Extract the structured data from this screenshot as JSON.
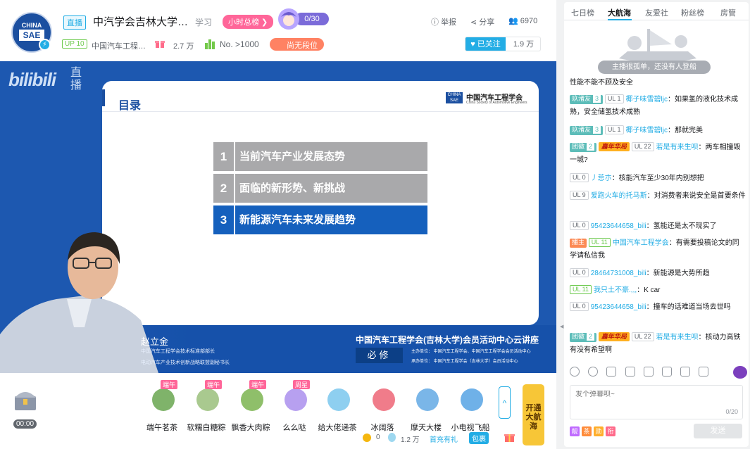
{
  "header": {
    "status": "直播",
    "title": "中汽学会吉林大学…",
    "area": "学习",
    "rank_pill": "小时总榜 ❯",
    "guard_count": "0/30",
    "report": "举报",
    "share": "分享",
    "viewers": "6970",
    "avatar_text_top": "CHINA",
    "avatar_text_main": "SAE",
    "up_level": "UP 10",
    "org_name": "中国汽车工程…",
    "gift_value": "2.7 万",
    "rank": "No. >1000",
    "segment": "尚无段位",
    "follow": "已关注",
    "fans": "1.9 万"
  },
  "player": {
    "logo": "bilibili",
    "logo_live": "直播",
    "slide": {
      "title": "目录",
      "org_logo": "CHINA SAE",
      "org_cn": "中国汽车工程学会",
      "org_en": "China Society of Automotive Engineers",
      "items": [
        {
          "num": "1",
          "text": "当前汽车产业发展态势"
        },
        {
          "num": "2",
          "text": "面临的新形势、新挑战"
        },
        {
          "num": "3",
          "text": "新能源汽车未来发展趋势"
        }
      ]
    },
    "speaker_name": "赵立金",
    "speaker_role1": "中国汽车工程学会技术标准部部长",
    "speaker_role2": "电动汽车产业技术创新战略联盟副秘书长",
    "lecture": "中国汽车工程学会(吉林大学)会员活动中心云讲座",
    "required": "必修",
    "organizer": "主办单位：   中国汽车工程学会、中国汽车工程学会会员活动中心",
    "host": "承办单位：   中国汽车工程学会（吉林大学）会员活动中心"
  },
  "giftbar": {
    "timer": "00:00",
    "gifts": [
      {
        "name": "端午茗茶",
        "tag": "端午",
        "color": "#7fb36a"
      },
      {
        "name": "软糯白糖粽",
        "tag": "端午",
        "color": "#a9c98f"
      },
      {
        "name": "飘香大肉粽",
        "tag": "端午",
        "color": "#8fbf6a"
      },
      {
        "name": "么么哒",
        "tag": "周星",
        "color": "#b7a0f0"
      },
      {
        "name": "给大佬递茶",
        "tag": "",
        "color": "#8ecff0"
      },
      {
        "name": "冰阔落",
        "tag": "",
        "color": "#f07c8a"
      },
      {
        "name": "摩天大楼",
        "tag": "",
        "color": "#7ab6e8"
      },
      {
        "name": "小电视飞船",
        "tag": "",
        "color": "#6fb1e8"
      }
    ],
    "expand": "^",
    "open_guard": "开通大航海",
    "gold": "0",
    "silver": "1.2 万",
    "recharge": "首充有礼",
    "bag": "包裹"
  },
  "sidebar": {
    "tabs": [
      "七日榜",
      "大航海",
      "友爱社",
      "粉丝榜",
      "房管"
    ],
    "active_tab": 1,
    "empty_msg": "主播很孤单，还没有人登船",
    "messages": [
      {
        "text": "性能不能不顾及安全"
      },
      {
        "medal": "玖渚友",
        "medal_lv": "3",
        "ul": "UL 1",
        "user": "椰子味雪碧ljc",
        "text": "：如果氢的液化技术成熟，安全储氢技术成熟"
      },
      {
        "medal": "玖渚友",
        "medal_lv": "3",
        "ul": "UL 1",
        "user": "椰子味雪碧ljc",
        "text": "：那就完美"
      },
      {
        "medal": "团徽",
        "medal_lv": "2",
        "event": "嘉年华局",
        "ul": "UL 22",
        "user": "若是有来生呗",
        "text": "：两车相撞毁一城?"
      },
      {
        "ul": "UL 0",
        "user": "丿莣朩",
        "text": "：核能汽车至少30年内别想把"
      },
      {
        "ul": "UL 9",
        "user": "爱跑火车的托马斯",
        "text": "：对消费者来说安全是首要条件"
      },
      {
        "ul": "UL 0",
        "user": "95423644658_bili",
        "text": "：氢能还是太不现实了"
      },
      {
        "medal": "播主",
        "medal_lv": "",
        "ul": "UL 11",
        "user": "中国汽车工程学会",
        "text": "：有需要投稿论文的同学请私信我"
      },
      {
        "ul": "UL 0",
        "user": "28464731008_bili",
        "text": "：新能源是大势所趋"
      },
      {
        "ul": "UL 11",
        "user": "我只土不豪.,,,",
        "text": "：K car"
      },
      {
        "ul": "UL 0",
        "user": "95423644658_bili",
        "text": "：撞车的话难道当场去世吗"
      },
      {
        "medal": "团徽",
        "medal_lv": "2",
        "event": "嘉年华局",
        "ul": "UL 22",
        "user": "若是有来生呗",
        "text": "：核动力高铁有没有希望啊"
      }
    ],
    "input_placeholder": "发个弹幕呗~",
    "count": "0/20",
    "tools": [
      "靓",
      "茶",
      "勋",
      "衔"
    ],
    "send": "发送"
  },
  "colors": {
    "accent": "#23ade5",
    "player_bg": "#1d58b0",
    "toc_active": "#1560bd",
    "pink": "#ff6699"
  }
}
